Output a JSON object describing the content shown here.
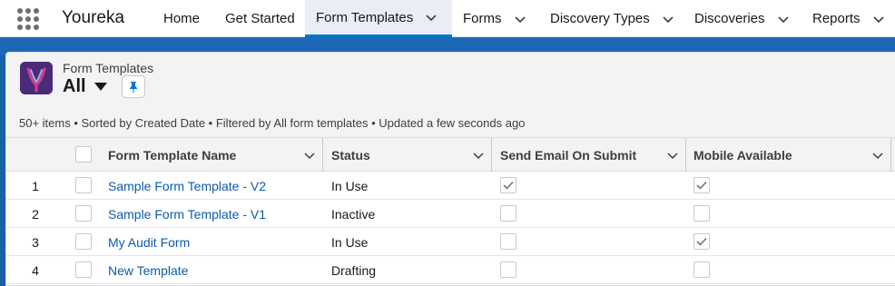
{
  "app": {
    "name": "Youreka"
  },
  "nav": {
    "items": [
      {
        "label": "Home",
        "has_menu": false,
        "active": false
      },
      {
        "label": "Get Started",
        "has_menu": false,
        "active": false
      },
      {
        "label": "Form Templates",
        "has_menu": true,
        "active": true
      },
      {
        "label": "Forms",
        "has_menu": true,
        "active": false
      },
      {
        "label": "Discovery Types",
        "has_menu": true,
        "active": false
      },
      {
        "label": "Discoveries",
        "has_menu": true,
        "active": false
      },
      {
        "label": "Reports",
        "has_menu": true,
        "active": false
      }
    ]
  },
  "header": {
    "object_label": "Form Templates",
    "list_view_name": "All",
    "status_text": "50+ items • Sorted by Created Date • Filtered by All form templates • Updated a few seconds ago"
  },
  "table": {
    "columns": [
      {
        "label": "Form Template Name"
      },
      {
        "label": "Status"
      },
      {
        "label": "Send Email On Submit"
      },
      {
        "label": "Mobile Available"
      }
    ],
    "rows": [
      {
        "num": "1",
        "name": "Sample Form Template - V2",
        "status": "In Use",
        "send_email": true,
        "mobile": true
      },
      {
        "num": "2",
        "name": "Sample Form Template - V1",
        "status": "Inactive",
        "send_email": false,
        "mobile": false
      },
      {
        "num": "3",
        "name": "My Audit Form",
        "status": "In Use",
        "send_email": false,
        "mobile": true
      },
      {
        "num": "4",
        "name": "New Template",
        "status": "Drafting",
        "send_email": false,
        "mobile": false
      }
    ]
  },
  "colors": {
    "brand_band": "#1b5fa6",
    "link": "#0b5cab",
    "active_tab_bg": "#e9eef5",
    "accent": "#0176d3"
  },
  "icons": {
    "app_launcher": "waffle-icon",
    "pin": "pin-icon",
    "list_caret": "caret-down-icon",
    "menu": "chevron-down-icon",
    "checked": "checkmark-icon"
  }
}
